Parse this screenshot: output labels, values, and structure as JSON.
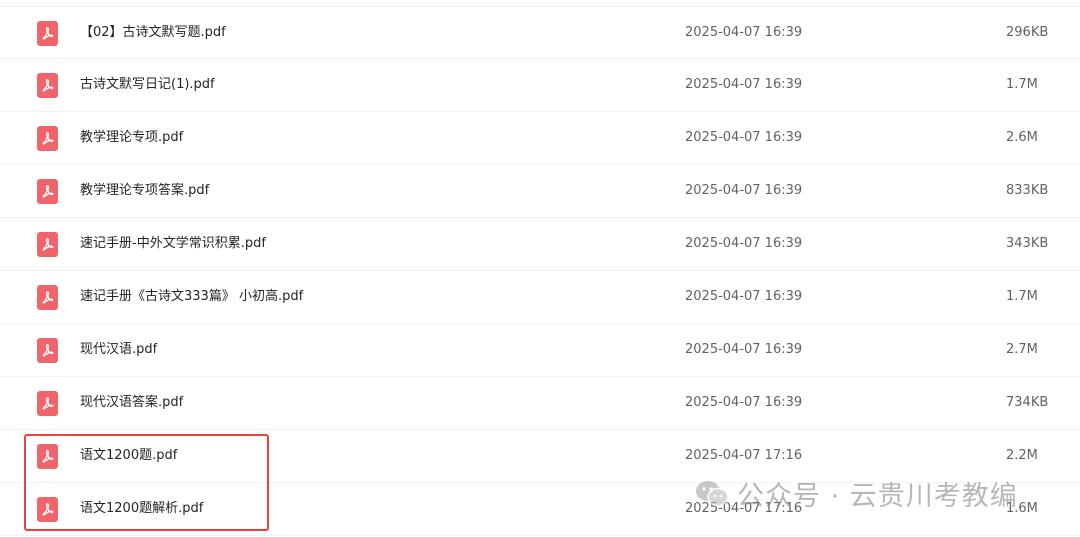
{
  "files": [
    {
      "icon": "pdf-file-icon",
      "name": "【02】古诗文默写题.pdf",
      "modified": "2025-04-07 16:39",
      "size": "296KB"
    },
    {
      "icon": "pdf-file-icon",
      "name": "古诗文默写日记(1).pdf",
      "modified": "2025-04-07 16:39",
      "size": "1.7M"
    },
    {
      "icon": "pdf-file-icon",
      "name": "教学理论专项.pdf",
      "modified": "2025-04-07 16:39",
      "size": "2.6M"
    },
    {
      "icon": "pdf-file-icon",
      "name": "教学理论专项答案.pdf",
      "modified": "2025-04-07 16:39",
      "size": "833KB"
    },
    {
      "icon": "pdf-file-icon",
      "name": "速记手册-中外文学常识积累.pdf",
      "modified": "2025-04-07 16:39",
      "size": "343KB"
    },
    {
      "icon": "pdf-file-icon",
      "name": "速记手册《古诗文333篇》 小初高.pdf",
      "modified": "2025-04-07 16:39",
      "size": "1.7M"
    },
    {
      "icon": "pdf-file-icon",
      "name": "现代汉语.pdf",
      "modified": "2025-04-07 16:39",
      "size": "2.7M"
    },
    {
      "icon": "pdf-file-icon",
      "name": "现代汉语答案.pdf",
      "modified": "2025-04-07 16:39",
      "size": "734KB"
    },
    {
      "icon": "pdf-file-icon",
      "name": "语文1200题.pdf",
      "modified": "2025-04-07 17:16",
      "size": "2.2M"
    },
    {
      "icon": "pdf-file-icon",
      "name": "语文1200题解析.pdf",
      "modified": "2025-04-07 17:16",
      "size": "1.6M"
    }
  ],
  "watermark": {
    "icon": "wechat-icon",
    "text": "公众号 · 云贵川考教编"
  },
  "colors": {
    "pdf_icon": "#f0656b",
    "highlight_border": "#e8413f",
    "row_divider": "#f1f2f4"
  }
}
